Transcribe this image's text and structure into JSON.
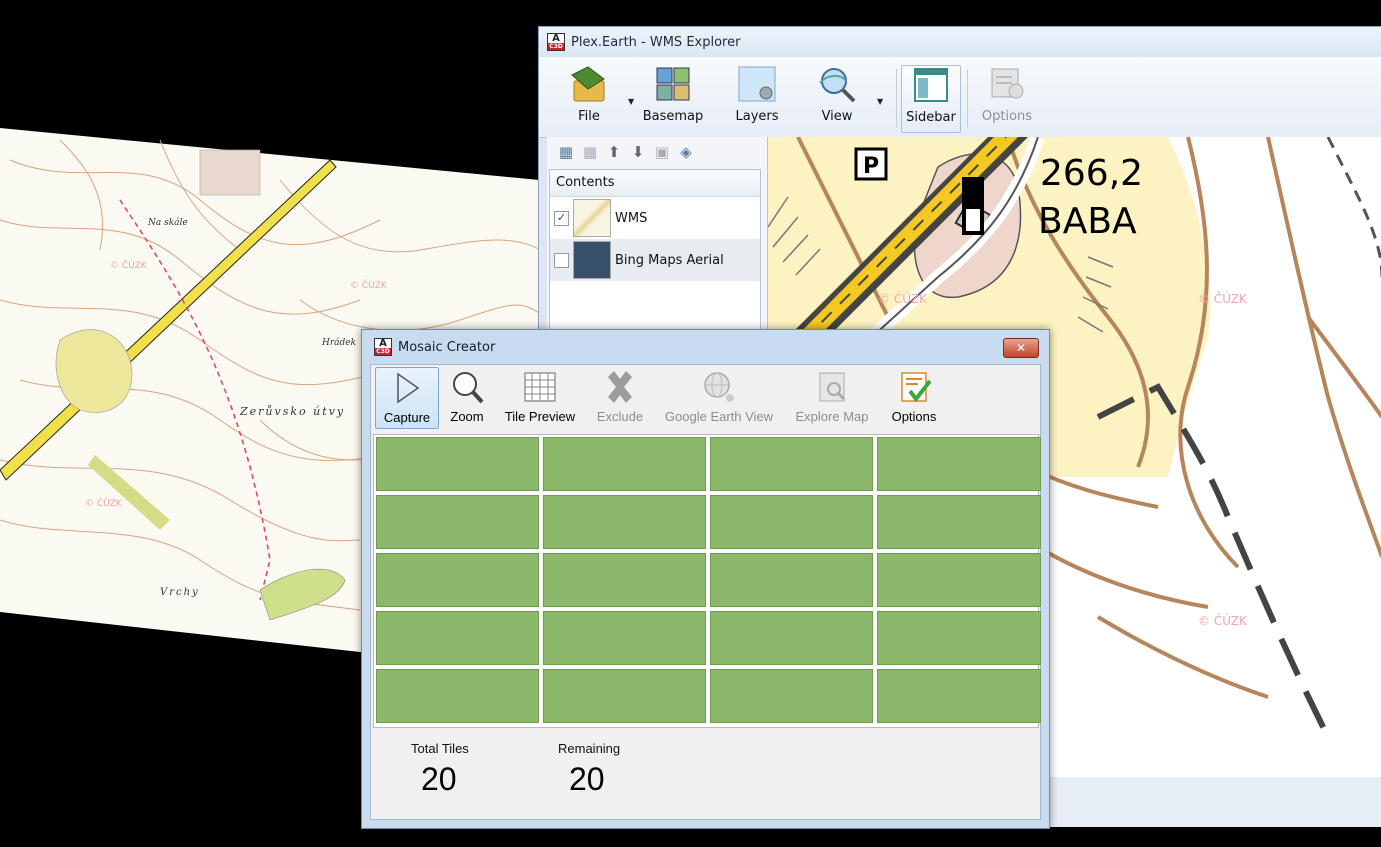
{
  "wms_window": {
    "title": "Plex.Earth - WMS Explorer",
    "ribbon": [
      {
        "label": "File",
        "icon": "file-folder-icon",
        "has_dropdown": true
      },
      {
        "label": "Basemap",
        "icon": "basemap-icon"
      },
      {
        "label": "Layers",
        "icon": "layers-icon"
      },
      {
        "label": "View",
        "icon": "view-magnifier-icon",
        "has_dropdown": true
      },
      {
        "label": "Sidebar",
        "icon": "sidebar-icon"
      },
      {
        "label": "Options",
        "icon": "options-icon",
        "disabled": true
      }
    ],
    "contents_header": "Contents",
    "layers": [
      {
        "name": "WMS",
        "checked": true
      },
      {
        "name": "Bing Maps Aerial",
        "checked": false
      }
    ],
    "map_labels": {
      "parking": "P",
      "elevation": "266,2",
      "place": "BABA",
      "watermark": "© ČÚZK"
    }
  },
  "mosaic_dialog": {
    "title": "Mosaic Creator",
    "close_label": "✕",
    "tools": [
      {
        "label": "Capture",
        "active": true
      },
      {
        "label": "Zoom"
      },
      {
        "label": "Tile Preview"
      },
      {
        "label": "Exclude",
        "disabled": true
      },
      {
        "label": "Google Earth View",
        "disabled": true
      },
      {
        "label": "Explore Map",
        "disabled": true
      },
      {
        "label": "Options"
      }
    ],
    "grid": {
      "rows": 5,
      "cols": 4,
      "tile_color": "#8cb86a"
    },
    "stats": {
      "total_label": "Total Tiles",
      "total_value": "20",
      "remaining_label": "Remaining",
      "remaining_value": "20"
    }
  },
  "background_map": {
    "watermark": "© ČÚZK",
    "labels": [
      "Na skále",
      "Zerůvsko útvy",
      "Vrchy",
      "Hrádek"
    ]
  }
}
